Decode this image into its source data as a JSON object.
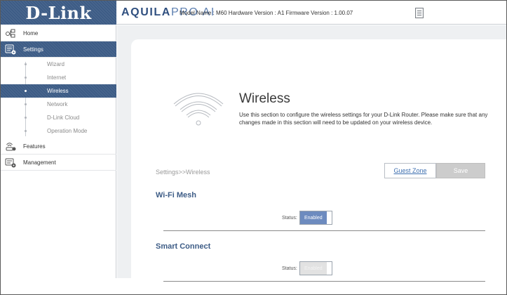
{
  "header": {
    "logo": "D-Link",
    "product_brand": "AQUILA",
    "product_suffix": "PRO AI",
    "model_info": "Model Name : M60 Hardware Version : A1 Firmware Version : 1.00.07",
    "doc_icon": "document-icon"
  },
  "sidebar": {
    "items": [
      {
        "label": "Home",
        "icon": "home-icon"
      },
      {
        "label": "Settings",
        "icon": "settings-icon",
        "active": true
      },
      {
        "label": "Features",
        "icon": "features-icon"
      },
      {
        "label": "Management",
        "icon": "management-icon"
      }
    ],
    "settings_sub": [
      {
        "label": "Wizard"
      },
      {
        "label": "Internet"
      },
      {
        "label": "Wireless",
        "active": true
      },
      {
        "label": "Network"
      },
      {
        "label": "D-Link Cloud"
      },
      {
        "label": "Operation Mode"
      }
    ]
  },
  "main": {
    "title": "Wireless",
    "description": "Use this section to configure the wireless settings for your D-Link Router. Please make sure that any changes made in this section will need to be updated on your wireless device.",
    "breadcrumb": "Settings>>Wireless",
    "guest_zone_label": "Guest Zone",
    "save_label": "Save",
    "sections": [
      {
        "title": "Wi-Fi Mesh",
        "status_label": "Status:",
        "toggle_text": "Enabled",
        "enabled": true
      },
      {
        "title": "Smart Connect",
        "status_label": "Status:",
        "toggle_text": "Enabled",
        "enabled": false
      }
    ]
  },
  "colors": {
    "brand_blue": "#3d5c86",
    "toggle_on": "#6d8bbf",
    "link": "#3d6fb0"
  }
}
